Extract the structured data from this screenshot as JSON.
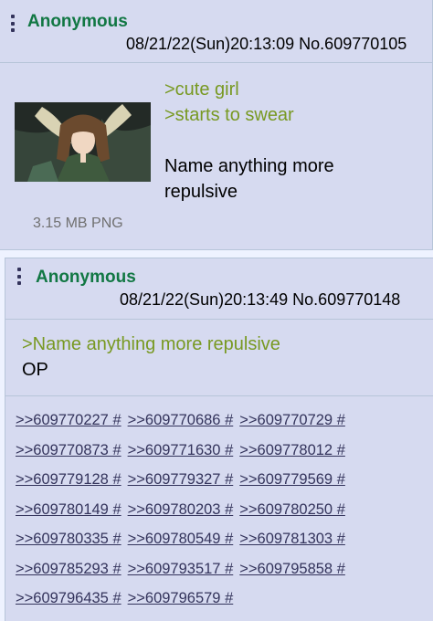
{
  "posts": [
    {
      "name": "Anonymous",
      "datetime": "08/21/22(Sun)20:13:09",
      "post_no": "No.609770105",
      "greentext_lines": [
        ">cute girl",
        ">starts to swear"
      ],
      "text_lines": [
        "Name anything more",
        "repulsive"
      ],
      "file_info": "3.15 MB PNG"
    },
    {
      "name": "Anonymous",
      "datetime": "08/21/22(Sun)20:13:49",
      "post_no": "No.609770148",
      "greentext_lines": [
        ">Name anything more repulsive"
      ],
      "text_lines": [
        "OP"
      ],
      "replies": [
        [
          ">>609770227 #",
          ">>609770686 #",
          ">>609770729 #"
        ],
        [
          ">>609770873 #",
          ">>609771630 #",
          ">>609778012 #"
        ],
        [
          ">>609779128 #",
          ">>609779327 #",
          ">>609779569 #"
        ],
        [
          ">>609780149 #",
          ">>609780203 #",
          ">>609780250 #"
        ],
        [
          ">>609780335 #",
          ">>609780549 #",
          ">>609781303 #"
        ],
        [
          ">>609785293 #",
          ">>609793517 #",
          ">>609795858 #"
        ],
        [
          ">>609796435 #",
          ">>609796579 #"
        ]
      ]
    }
  ],
  "colors": {
    "background": "#eef2ff",
    "post_background": "#d6daf0",
    "name": "#117743",
    "greentext": "#789922",
    "link": "#34345c"
  }
}
